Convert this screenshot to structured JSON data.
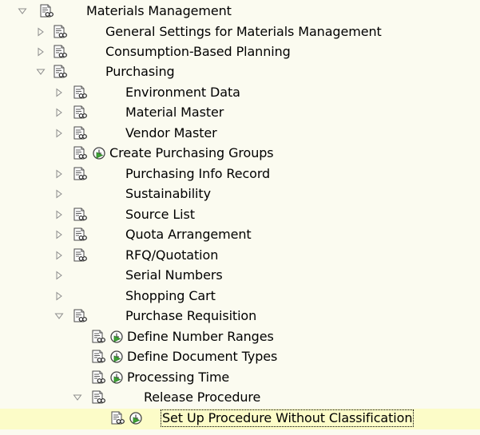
{
  "tree": [
    {
      "label": "Materials Management",
      "expander": "expanded",
      "doc": true,
      "exec": false,
      "selected": false
    },
    {
      "label": "General Settings for Materials Management",
      "expander": "collapsed",
      "doc": true,
      "exec": false,
      "selected": false
    },
    {
      "label": "Consumption-Based Planning",
      "expander": "collapsed",
      "doc": true,
      "exec": false,
      "selected": false
    },
    {
      "label": "Purchasing",
      "expander": "expanded",
      "doc": true,
      "exec": false,
      "selected": false
    },
    {
      "label": "Environment Data",
      "expander": "collapsed",
      "doc": true,
      "exec": false,
      "selected": false
    },
    {
      "label": "Material Master",
      "expander": "collapsed",
      "doc": true,
      "exec": false,
      "selected": false
    },
    {
      "label": "Vendor Master",
      "expander": "collapsed",
      "doc": true,
      "exec": false,
      "selected": false
    },
    {
      "label": "Create Purchasing Groups",
      "expander": "none",
      "doc": true,
      "exec": true,
      "selected": false
    },
    {
      "label": "Purchasing Info Record",
      "expander": "collapsed",
      "doc": true,
      "exec": false,
      "selected": false
    },
    {
      "label": "Sustainability",
      "expander": "collapsed",
      "doc": false,
      "exec": false,
      "selected": false
    },
    {
      "label": "Source List",
      "expander": "collapsed",
      "doc": true,
      "exec": false,
      "selected": false
    },
    {
      "label": "Quota Arrangement",
      "expander": "collapsed",
      "doc": true,
      "exec": false,
      "selected": false
    },
    {
      "label": "RFQ/Quotation",
      "expander": "collapsed",
      "doc": true,
      "exec": false,
      "selected": false
    },
    {
      "label": "Serial Numbers",
      "expander": "collapsed",
      "doc": false,
      "exec": false,
      "selected": false
    },
    {
      "label": "Shopping Cart",
      "expander": "collapsed",
      "doc": false,
      "exec": false,
      "selected": false
    },
    {
      "label": "Purchase Requisition",
      "expander": "expanded",
      "doc": true,
      "exec": false,
      "selected": false
    },
    {
      "label": "Define Number Ranges",
      "expander": "none",
      "doc": true,
      "exec": true,
      "selected": false
    },
    {
      "label": "Define Document Types",
      "expander": "none",
      "doc": true,
      "exec": true,
      "selected": false
    },
    {
      "label": "Processing Time",
      "expander": "none",
      "doc": true,
      "exec": true,
      "selected": false
    },
    {
      "label": "Release Procedure",
      "expander": "expanded",
      "doc": true,
      "exec": false,
      "selected": false
    },
    {
      "label": "Set Up Procedure Without Classification",
      "expander": "none",
      "doc": true,
      "exec": true,
      "selected": true
    }
  ],
  "colors": {
    "background": "#fbfbf0",
    "highlight": "#fcfcc8",
    "exec_green": "#3fa535",
    "arrow": "#8c8c8c"
  },
  "icons": {
    "expanded": "triangle-down-icon",
    "collapsed": "triangle-right-icon",
    "doc": "document-with-glasses-icon",
    "exec": "execute-clock-icon"
  }
}
